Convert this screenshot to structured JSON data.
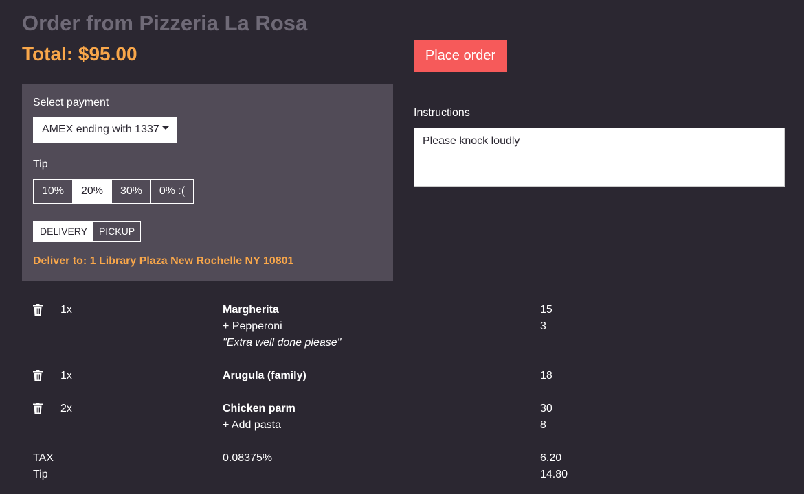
{
  "header": {
    "title": "Order from Pizzeria La Rosa",
    "total": "Total: $95.00",
    "place_order_label": "Place order"
  },
  "colors": {
    "background": "#2b2731",
    "panel": "#514b57",
    "accent_orange": "#f9a74a",
    "button_red": "#f65a5a",
    "title_gray": "#6f6a77"
  },
  "payment": {
    "label": "Select payment",
    "selected": "AMEX ending with 1337"
  },
  "tip": {
    "label": "Tip",
    "options": [
      {
        "label": "10%",
        "selected": false
      },
      {
        "label": "20%",
        "selected": true
      },
      {
        "label": "30%",
        "selected": false
      },
      {
        "label": "0% :(",
        "selected": false
      }
    ]
  },
  "fulfillment": {
    "options": [
      {
        "label": "DELIVERY",
        "selected": true
      },
      {
        "label": "PICKUP",
        "selected": false
      }
    ],
    "deliver_to": "Deliver to: 1 Library Plaza New Rochelle NY 10801"
  },
  "instructions": {
    "label": "Instructions",
    "value": "Please knock loudly"
  },
  "items": [
    {
      "qty": "1x",
      "name": "Margherita",
      "price": "15",
      "addons": [
        {
          "label": "+ Pepperoni",
          "price": "3"
        }
      ],
      "note": "\"Extra well done please\""
    },
    {
      "qty": "1x",
      "name": "Arugula (family)",
      "price": "18",
      "addons": [],
      "note": ""
    },
    {
      "qty": "2x",
      "name": "Chicken parm",
      "price": "30",
      "addons": [
        {
          "label": "+ Add pasta",
          "price": "8"
        }
      ],
      "note": ""
    }
  ],
  "summary": {
    "tax_label": "TAX",
    "tax_rate": "0.08375%",
    "tax_amount": "6.20",
    "tip_label": "Tip",
    "tip_amount": "14.80"
  },
  "icons": {
    "remove_item": "trash-icon"
  }
}
